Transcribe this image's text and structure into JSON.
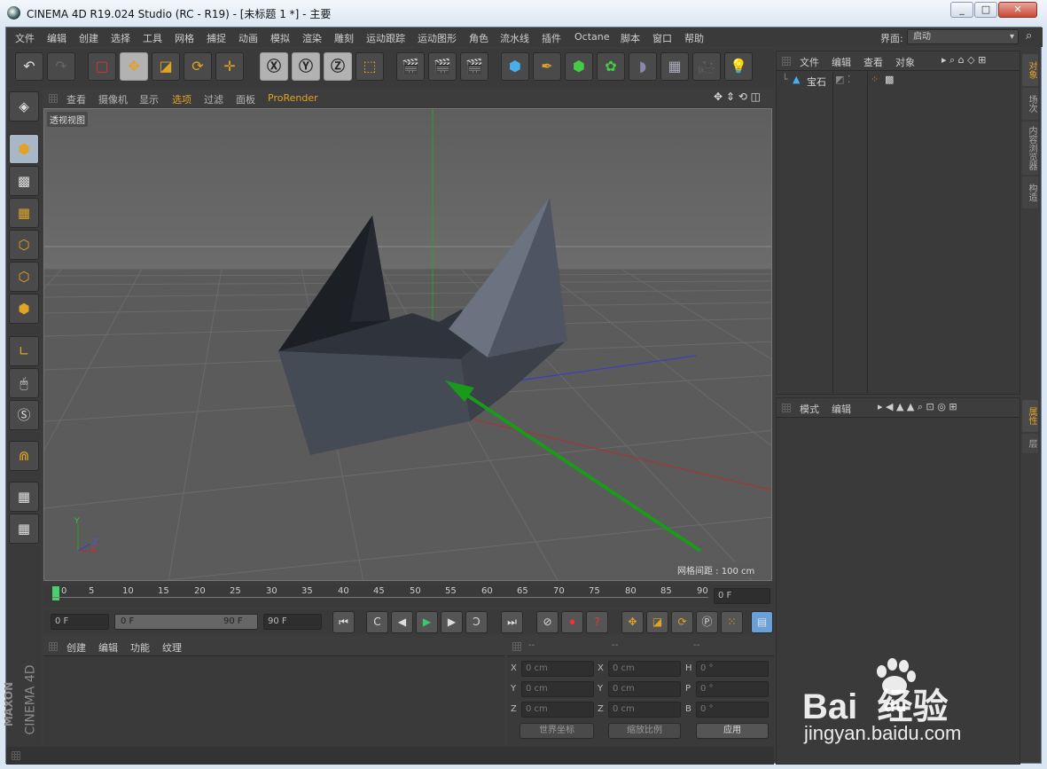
{
  "window": {
    "title": "CINEMA 4D R19.024 Studio (RC - R19) - [未标题 1 *] - 主要",
    "min": "_",
    "max": "□",
    "close": "✕"
  },
  "menu": [
    "文件",
    "编辑",
    "创建",
    "选择",
    "工具",
    "网格",
    "捕捉",
    "动画",
    "模拟",
    "渲染",
    "雕刻",
    "运动跟踪",
    "运动图形",
    "角色",
    "流水线",
    "插件",
    "Octane",
    "脚本",
    "窗口",
    "帮助"
  ],
  "layout": {
    "label": "界面:",
    "value": "启动"
  },
  "viewport_menu": [
    "查看",
    "摄像机",
    "显示",
    "选项",
    "过滤",
    "面板",
    "ProRender"
  ],
  "viewport": {
    "label": "透视视图",
    "grid_spacing": "网格间距 : 100 cm",
    "axis_y": "Y",
    "axis_x": "X",
    "axis_z": "Z"
  },
  "timeline": {
    "ticks": [
      "0",
      "5",
      "10",
      "15",
      "20",
      "25",
      "30",
      "35",
      "40",
      "45",
      "50",
      "55",
      "60",
      "65",
      "70",
      "75",
      "80",
      "85",
      "90"
    ],
    "current_frame": "0 F"
  },
  "transport": {
    "start": "0 F",
    "range_start": "0 F",
    "range_end": "90 F",
    "end": "90 F"
  },
  "material_menu": [
    "创建",
    "编辑",
    "功能",
    "纹理"
  ],
  "coords": {
    "headers": [
      "--",
      "--",
      "--"
    ],
    "pos_labels": [
      "X",
      "Y",
      "Z"
    ],
    "size_labels": [
      "X",
      "Y",
      "Z"
    ],
    "rot_labels": [
      "H",
      "P",
      "B"
    ],
    "pos": [
      "0 cm",
      "0 cm",
      "0 cm"
    ],
    "size": [
      "0 cm",
      "0 cm",
      "0 cm"
    ],
    "rot": [
      "0 °",
      "0 °",
      "0 °"
    ],
    "world": "世界坐标",
    "scale": "缩放比例",
    "apply": "应用"
  },
  "object_menu": [
    "文件",
    "编辑",
    "查看",
    "对象"
  ],
  "objects": [
    {
      "name": "宝石"
    }
  ],
  "attr_menu": [
    "模式",
    "编辑"
  ],
  "right_tabs_top": [
    "对象",
    "场次",
    "内容浏览器",
    "构造"
  ],
  "right_tabs_bottom": [
    "属性",
    "层"
  ],
  "brand": {
    "maxon": "MAXON",
    "product": "CINEMA 4D"
  },
  "watermark": {
    "text": "Bai  经验",
    "du": "du",
    "url": "jingyan.baidu.com"
  },
  "colors": {
    "accent": "#e0a324",
    "viewport_bg": "#626262",
    "annotation_arrow": "#1a9a1a"
  }
}
